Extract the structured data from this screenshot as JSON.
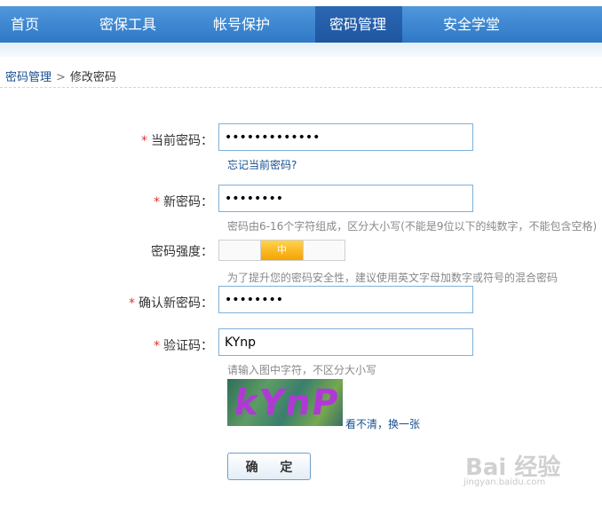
{
  "nav": {
    "tabs": [
      "首页",
      "密保工具",
      "帐号保护",
      "密码管理",
      "安全学堂"
    ],
    "active": "密码管理"
  },
  "breadcrumb": {
    "parent": "密码管理",
    "separator": ">",
    "current": "修改密码"
  },
  "form": {
    "required_mark": "*",
    "current_password": {
      "label": "当前密码：",
      "value": "•••••••••••••",
      "forgot_link": "忘记当前密码?"
    },
    "new_password": {
      "label": "新密码：",
      "value": "••••••••",
      "hint": "密码由6-16个字符组成，区分大小写(不能是9位以下的纯数字，不能包含空格)"
    },
    "strength": {
      "label": "密码强度：",
      "segments": [
        "",
        "中",
        ""
      ],
      "active_index": 1,
      "hint": "为了提升您的密码安全性，建议使用英文字母加数字或符号的混合密码"
    },
    "confirm_password": {
      "label": "确认新密码：",
      "value": "••••••••"
    },
    "captcha": {
      "label": "验证码：",
      "value": "KYnp",
      "hint": "请输入图中字符，不区分大小写",
      "image_text": "kYnP",
      "refresh_link": "看不清，换一张"
    },
    "submit_label": "确 定"
  },
  "watermark": {
    "main": "Bai 经验",
    "sub": "jingyan.baidu.com"
  },
  "colors": {
    "nav_blue": "#3a86d2",
    "nav_active": "#2460ab",
    "link": "#15508f",
    "required": "#e8312f",
    "strength_on": "#f5a300",
    "captcha_text": "#b039d6"
  }
}
